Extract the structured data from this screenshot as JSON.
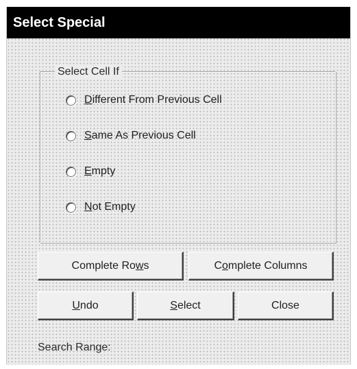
{
  "dialog": {
    "title": "Select Special"
  },
  "group": {
    "label": "Select Cell If",
    "options": [
      {
        "label": "Different From Previous Cell",
        "accel": "D",
        "rest": "ifferent From Previous Cell",
        "selected": false
      },
      {
        "label": "Same As Previous Cell",
        "accel": "S",
        "rest": "ame As Previous Cell",
        "selected": false
      },
      {
        "label": "Empty",
        "accel": "E",
        "rest": "mpty",
        "selected": false
      },
      {
        "label": "Not Empty",
        "accel": "N",
        "rest": "ot Empty",
        "selected": false
      }
    ]
  },
  "buttons": {
    "complete_rows_pre": "Complete Ro",
    "complete_rows_accel": "w",
    "complete_rows_post": "s",
    "complete_columns_pre": "C",
    "complete_columns_accel": "o",
    "complete_columns_post": "mplete Columns",
    "undo_accel": "U",
    "undo_post": "ndo",
    "select_accel": "S",
    "select_post": "elect",
    "close": "Close"
  },
  "status": {
    "search_range_label": "Search Range:"
  },
  "colors": {
    "titlebar_bg": "#000000",
    "titlebar_text": "#ffffff",
    "dialog_bg": "#ececec"
  }
}
